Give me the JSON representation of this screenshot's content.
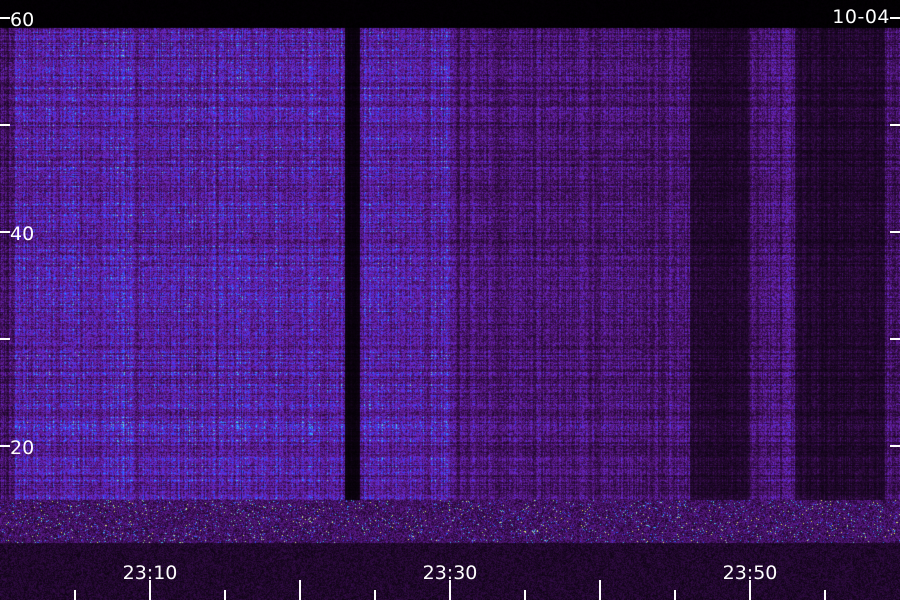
{
  "chart_data": {
    "type": "heatmap",
    "title": "",
    "date_label": "10-04",
    "xlabel": "",
    "ylabel": "",
    "ylim": [
      10,
      60
    ],
    "y_major_ticks": [
      20,
      40,
      60
    ],
    "y_minor_ticks": [
      30,
      50
    ],
    "y_tick_labels": [
      "20",
      "40",
      "60"
    ],
    "x_tick_labels": [
      "23:10",
      "23:30",
      "23:50"
    ],
    "x_major_ticks": [
      "23:10",
      "23:20",
      "23:30",
      "23:40",
      "23:50"
    ],
    "x_minor_ticks": [
      "23:05",
      "23:15",
      "23:25",
      "23:35",
      "23:45",
      "23:55"
    ],
    "colormap": [
      "#000000",
      "#2a0a3a",
      "#5a1a8a",
      "#6a2ad0",
      "#3040ff",
      "#30c0ff",
      "#ffff60"
    ],
    "segments": [
      {
        "from": "23:01",
        "to": "23:23",
        "level": "high"
      },
      {
        "from": "23:23",
        "to": "23:24",
        "level": "dark"
      },
      {
        "from": "23:24",
        "to": "23:30",
        "level": "high"
      },
      {
        "from": "23:30",
        "to": "23:46",
        "level": "medium"
      },
      {
        "from": "23:46",
        "to": "23:50",
        "level": "low"
      },
      {
        "from": "23:50",
        "to": "23:53",
        "level": "medium"
      },
      {
        "from": "23:53",
        "to": "23:59",
        "level": "low"
      }
    ],
    "strong_signal_band": [
      11,
      15
    ]
  }
}
